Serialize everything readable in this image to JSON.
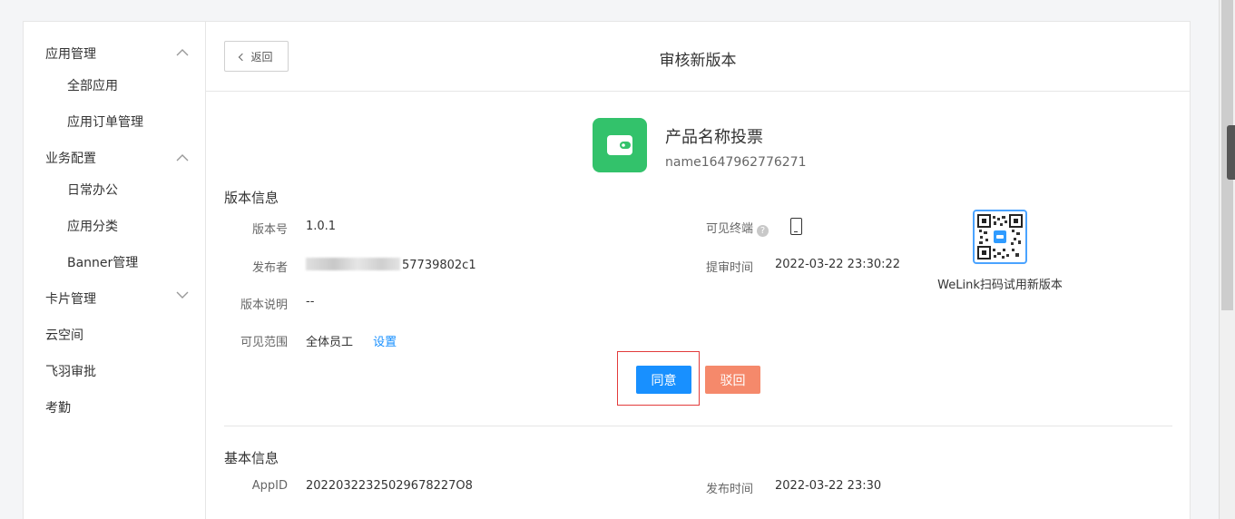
{
  "sidebar": {
    "groups": [
      {
        "label": "应用管理",
        "expanded": true,
        "items": [
          "全部应用",
          "应用订单管理"
        ]
      },
      {
        "label": "业务配置",
        "expanded": true,
        "items": [
          "日常办公",
          "应用分类",
          "Banner管理"
        ]
      },
      {
        "label": "卡片管理",
        "expanded": false,
        "items": []
      }
    ],
    "others": [
      "云空间",
      "飞羽审批",
      "考勤"
    ]
  },
  "header": {
    "back_label": "返回",
    "title": "审核新版本"
  },
  "app": {
    "name": "产品名称投票",
    "id": "name1647962776271",
    "icon": "wallet-icon",
    "icon_color": "#33c26b"
  },
  "version_info": {
    "title": "版本信息",
    "version_label": "版本号",
    "version_value": "1.0.1",
    "publisher_label": "发布者",
    "publisher_value": "57739802c1",
    "desc_label": "版本说明",
    "desc_value": "--",
    "scope_label": "可见范围",
    "scope_value": "全体员工",
    "scope_link": "设置",
    "terminal_label": "可见终端",
    "terminal_icon": "phone-icon",
    "submit_label": "提审时间",
    "submit_value": "2022-03-22 23:30:22",
    "qr_caption": "WeLink扫码试用新版本"
  },
  "actions": {
    "agree": "同意",
    "reject": "驳回",
    "agree_color": "#1890ff",
    "reject_color": "#f5896b"
  },
  "basic_info": {
    "title": "基本信息",
    "appid_label": "AppID",
    "appid_value": "20220322325029678227O8",
    "publish_label": "发布时间",
    "publish_value": "2022-03-22 23:30"
  }
}
